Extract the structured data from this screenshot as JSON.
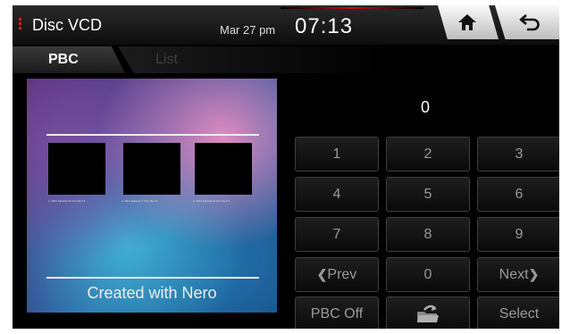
{
  "header": {
    "app_title": "Disc VCD",
    "date": "Mar 27 pm",
    "time": "07:13",
    "home_icon": "home-icon",
    "back_icon": "back-arrow-icon"
  },
  "tabs": [
    {
      "label": "PBC",
      "active": true
    },
    {
      "label": "List",
      "active": false
    }
  ],
  "video": {
    "thumb_captions": [
      "1. 2001 Episode I8 ACI Clip.FT",
      "2. 2001 Episode II ACI Clip.FT",
      "3. 2001 Episode III ACI Clip.FT"
    ],
    "caption": "Created with Nero"
  },
  "keypad": {
    "display_value": "0",
    "keys": [
      "1",
      "2",
      "3",
      "4",
      "5",
      "6",
      "7",
      "8",
      "9"
    ],
    "prev_label": "Prev",
    "zero_label": "0",
    "next_label": "Next",
    "pbc_off_label": "PBC Off",
    "eject_icon": "eject-folder-icon",
    "select_label": "Select"
  },
  "colors": {
    "accent_red": "#d81e1e",
    "key_text": "#9a9a9a",
    "background": "#000000"
  }
}
